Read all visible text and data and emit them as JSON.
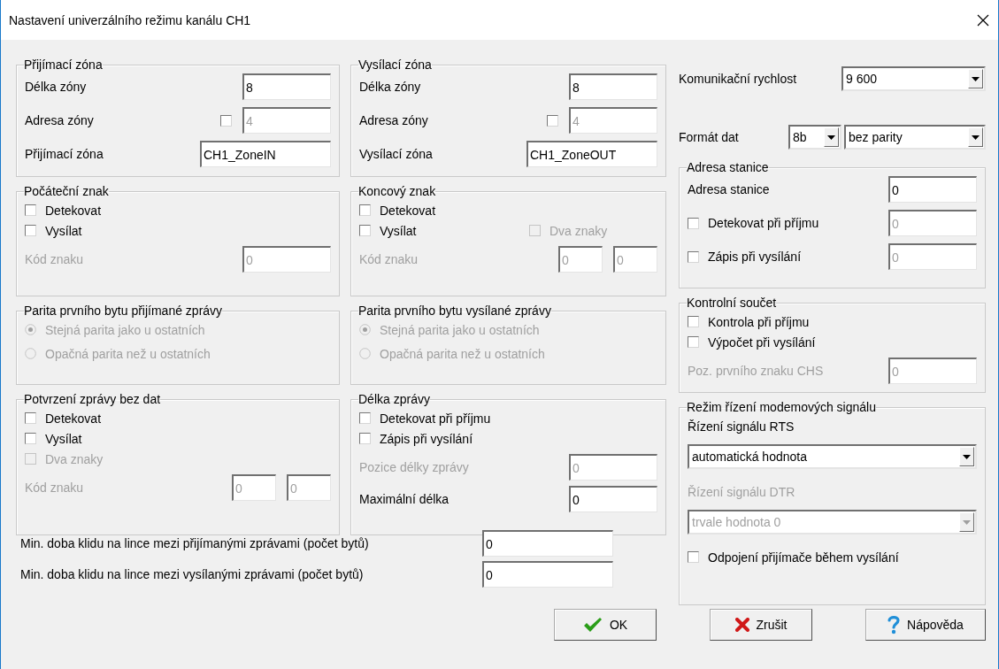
{
  "window": {
    "title": "Nastavení univerzálního režimu kanálu CH1"
  },
  "columns": [
    {
      "groups": [
        {
          "title": "Přijímací zóna",
          "rows": [
            {
              "kind": "field",
              "label": "Délka zóny",
              "disabled": false,
              "inputs": [
                {
                  "value": "8",
                  "disabled": false
                }
              ]
            },
            {
              "kind": "field",
              "label": "Adresa zóny",
              "disabled": false,
              "checkbox": {
                "checked": false,
                "disabled": false
              },
              "inputs": [
                {
                  "value": "4",
                  "disabled": true
                }
              ]
            },
            {
              "kind": "name",
              "label": "Přijímací zóna",
              "disabled": false,
              "inputs": [
                {
                  "value": "CH1_ZoneIN",
                  "disabled": false
                }
              ]
            }
          ]
        },
        {
          "title": "Počáteční znak",
          "rows": [
            {
              "kind": "check",
              "label": "Detekovat",
              "checked": false,
              "disabled": false
            },
            {
              "kind": "check",
              "label": "Vysílat",
              "checked": false,
              "disabled": false
            },
            {
              "kind": "field",
              "label": "Kód znaku",
              "disabled": true,
              "inputs": [
                {
                  "value": "0",
                  "disabled": true
                }
              ]
            }
          ]
        },
        {
          "title": "Parita prvního bytu přijímané zprávy",
          "rows": [
            {
              "kind": "radio",
              "label": "Stejná parita jako u ostatních",
              "selected": true,
              "disabled": true
            },
            {
              "kind": "radio",
              "label": "Opačná parita než u ostatních",
              "selected": false,
              "disabled": true
            }
          ]
        },
        {
          "title": "Potvrzení zprávy bez dat",
          "rows": [
            {
              "kind": "check",
              "label": "Detekovat",
              "checked": false,
              "disabled": false
            },
            {
              "kind": "check",
              "label": "Vysílat",
              "checked": false,
              "disabled": false
            },
            {
              "kind": "check",
              "label": "Dva znaky",
              "checked": false,
              "disabled": true
            },
            {
              "kind": "field",
              "label": "Kód znaku",
              "disabled": true,
              "inputs": [
                {
                  "value": "0",
                  "disabled": true
                },
                {
                  "value": "0",
                  "disabled": true
                }
              ]
            }
          ]
        }
      ]
    },
    {
      "groups": [
        {
          "title": "Vysílací zóna",
          "rows": [
            {
              "kind": "field",
              "label": "Délka zóny",
              "disabled": false,
              "inputs": [
                {
                  "value": "8",
                  "disabled": false
                }
              ]
            },
            {
              "kind": "field",
              "label": "Adresa zóny",
              "disabled": false,
              "checkbox": {
                "checked": false,
                "disabled": false
              },
              "inputs": [
                {
                  "value": "4",
                  "disabled": true
                }
              ]
            },
            {
              "kind": "name",
              "label": "Vysílací zóna",
              "disabled": false,
              "inputs": [
                {
                  "value": "CH1_ZoneOUT",
                  "disabled": false
                }
              ]
            }
          ]
        },
        {
          "title": "Koncový znak",
          "rows": [
            {
              "kind": "check",
              "label": "Detekovat",
              "checked": false,
              "disabled": false
            },
            {
              "kind": "check",
              "label": "Vysílat",
              "checked": false,
              "disabled": false,
              "extra": {
                "label": "Dva znaky",
                "checked": false,
                "disabled": true
              }
            },
            {
              "kind": "field",
              "label": "Kód znaku",
              "disabled": true,
              "inputs": [
                {
                  "value": "0",
                  "disabled": true
                },
                {
                  "value": "0",
                  "disabled": true
                }
              ]
            }
          ]
        },
        {
          "title": "Parita prvního bytu vysílané zprávy",
          "rows": [
            {
              "kind": "radio",
              "label": "Stejná parita jako u ostatních",
              "selected": true,
              "disabled": true
            },
            {
              "kind": "radio",
              "label": "Opačná parita než u ostatních",
              "selected": false,
              "disabled": true
            }
          ]
        },
        {
          "title": "Délka zprávy",
          "rows": [
            {
              "kind": "check",
              "label": "Detekovat při příjmu",
              "checked": false,
              "disabled": false
            },
            {
              "kind": "check",
              "label": "Zápis při vysílání",
              "checked": false,
              "disabled": false
            },
            {
              "kind": "field",
              "label": "Pozice délky zprávy",
              "disabled": true,
              "inputs": [
                {
                  "value": "0",
                  "disabled": true
                }
              ]
            },
            {
              "kind": "field",
              "label": "Maximální délka",
              "disabled": false,
              "inputs": [
                {
                  "value": "0",
                  "disabled": false
                }
              ]
            }
          ]
        }
      ]
    },
    {
      "rows": [
        {
          "kind": "select-field",
          "label": "Komunikační rychlost",
          "selects": [
            {
              "value": "9 600",
              "disabled": false
            }
          ]
        },
        {
          "kind": "select-field",
          "label": "Formát dat",
          "selects": [
            {
              "value": "8b",
              "disabled": false
            },
            {
              "value": "bez parity",
              "disabled": false
            }
          ]
        }
      ],
      "groups": [
        {
          "title": "Adresa stanice",
          "rows": [
            {
              "kind": "field",
              "label": "Adresa stanice",
              "disabled": false,
              "inputs": [
                {
                  "value": "0",
                  "disabled": false
                }
              ]
            },
            {
              "kind": "check",
              "label": "Detekovat při příjmu",
              "checked": false,
              "disabled": false,
              "inputs": [
                {
                  "value": "0",
                  "disabled": true
                }
              ]
            },
            {
              "kind": "check",
              "label": "Zápis při vysílání",
              "checked": false,
              "disabled": false,
              "inputs": [
                {
                  "value": "0",
                  "disabled": true
                }
              ]
            }
          ]
        },
        {
          "title": "Kontrolní součet",
          "rows": [
            {
              "kind": "check",
              "label": "Kontrola při příjmu",
              "checked": false,
              "disabled": false
            },
            {
              "kind": "check",
              "label": "Výpočet při vysílání",
              "checked": false,
              "disabled": false
            },
            {
              "kind": "field",
              "label": "Poz. prvního znaku CHS",
              "disabled": true,
              "inputs": [
                {
                  "value": "0",
                  "disabled": true
                }
              ]
            }
          ]
        },
        {
          "title": "Režim řízení modemových signálu",
          "rows": [
            {
              "kind": "caption",
              "label": "Řízení signálu RTS",
              "disabled": false
            },
            {
              "kind": "select",
              "value": "automatická hodnota",
              "disabled": false
            },
            {
              "kind": "caption",
              "label": "Řízení signálu DTR",
              "disabled": true
            },
            {
              "kind": "select",
              "value": "trvale hodnota 0",
              "disabled": true
            },
            {
              "kind": "check",
              "label": "Odpojení přijímače během vysílání",
              "checked": false,
              "disabled": false
            }
          ]
        }
      ]
    }
  ],
  "idle": [
    {
      "label": "Min. doba klidu na lince mezi přijímanými zprávami (počet bytů)",
      "value": "0"
    },
    {
      "label": "Min. doba klidu na lince mezi vysílanými zprávami (počet bytů)",
      "value": "0"
    }
  ],
  "buttons": [
    {
      "kind": "ok",
      "label": "OK"
    },
    {
      "kind": "cancel",
      "label": "Zrušit"
    },
    {
      "kind": "help",
      "label": "Nápověda"
    }
  ]
}
